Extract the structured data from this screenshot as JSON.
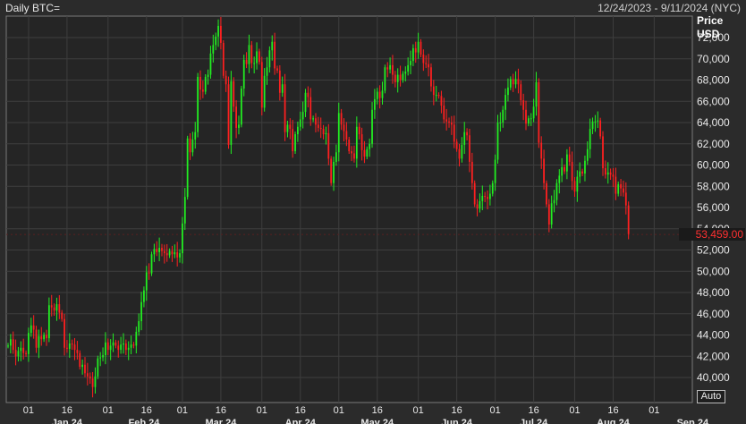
{
  "header": {
    "title": "Daily BTC=",
    "date_range": "12/24/2023 - 9/11/2024 (NYC)"
  },
  "controls": {
    "auto_label": "Auto"
  },
  "chart_data": {
    "type": "candlestick",
    "ylabel": "Price",
    "yunit": "USD",
    "ylim": [
      38400,
      74200
    ],
    "yticks": [
      40000,
      42000,
      44000,
      46000,
      48000,
      50000,
      52000,
      54000,
      56000,
      58000,
      60000,
      62000,
      64000,
      66000,
      68000,
      70000,
      72000
    ],
    "ytick_labels": [
      "40,000",
      "42,000",
      "44,000",
      "46,000",
      "48,000",
      "50,000",
      "52,000",
      "54,000",
      "56,000",
      "58,000",
      "60,000",
      "62,000",
      "64,000",
      "66,000",
      "68,000",
      "70,000",
      "72,000"
    ],
    "x_range": [
      "2023-12-24",
      "2024-09-11"
    ],
    "x_ticks": [
      {
        "date": "2024-01-01",
        "label": "01"
      },
      {
        "date": "2024-01-16",
        "label": "16"
      },
      {
        "date": "2024-02-01",
        "label": "01"
      },
      {
        "date": "2024-02-16",
        "label": "16"
      },
      {
        "date": "2024-03-01",
        "label": "01"
      },
      {
        "date": "2024-03-16",
        "label": "16"
      },
      {
        "date": "2024-04-01",
        "label": "01"
      },
      {
        "date": "2024-04-16",
        "label": "16"
      },
      {
        "date": "2024-05-01",
        "label": "01"
      },
      {
        "date": "2024-05-16",
        "label": "16"
      },
      {
        "date": "2024-06-01",
        "label": "01"
      },
      {
        "date": "2024-06-16",
        "label": "16"
      },
      {
        "date": "2024-07-01",
        "label": "01"
      },
      {
        "date": "2024-07-16",
        "label": "16"
      },
      {
        "date": "2024-08-01",
        "label": "01"
      },
      {
        "date": "2024-08-16",
        "label": "16"
      },
      {
        "date": "2024-09-01",
        "label": "01"
      }
    ],
    "months": [
      {
        "date": "2024-01-16",
        "label": "Jan 24"
      },
      {
        "date": "2024-02-15",
        "label": "Feb 24"
      },
      {
        "date": "2024-03-16",
        "label": "Mar 24"
      },
      {
        "date": "2024-04-16",
        "label": "Apr 24"
      },
      {
        "date": "2024-05-16",
        "label": "May 24"
      },
      {
        "date": "2024-06-16",
        "label": "Jun 24"
      },
      {
        "date": "2024-07-16",
        "label": "Jul 24"
      },
      {
        "date": "2024-08-16",
        "label": "Aug 24"
      },
      {
        "date": "2024-09-16",
        "label": "Sep 24"
      }
    ],
    "last_price": 53459.0,
    "last_price_label": "53,459.00",
    "colors": {
      "up": "#22ee22",
      "down": "#ff2020",
      "grid": "#3e3e3e",
      "last": "#ff3030"
    },
    "grid": true,
    "series": [
      {
        "date": "2023-12-24",
        "values": [
          43000,
          43600,
          42600,
          42000,
          42500,
          42800,
          42300,
          42200,
          44200,
          44900,
          44500,
          42800,
          43900,
          43600,
          44000,
          43700,
          46800,
          46600,
          46300,
          46900,
          46100,
          45500,
          42800,
          42700,
          43200,
          43100,
          42600,
          42300,
          41000,
          41200,
          40400,
          40100,
          39900,
          39100,
          40100,
          41800,
          41900,
          42100,
          43300,
          42600,
          43000,
          43300,
          43000,
          42600,
          43100,
          43200,
          42600,
          42800,
          43100,
          43000,
          44300,
          45300,
          47100,
          48200,
          49900,
          49800,
          51600,
          52100,
          51800,
          52200,
          51900,
          51700,
          51500,
          51900,
          51600,
          51800,
          51300,
          51700,
          54500,
          57000,
          62500,
          61200,
          62400,
          63100,
          68300,
          67100,
          66900,
          68300,
          68500,
          70500,
          71300,
          72100,
          73100,
          71500,
          68400,
          67600,
          61900,
          67900,
          65500,
          63500,
          63800,
          67200,
          69900,
          69500,
          71300,
          69600,
          69600,
          70700,
          69700,
          65400,
          68400,
          69200,
          70800,
          71600,
          69100,
          68900,
          66800,
          67600,
          63100,
          63800,
          63400,
          61300,
          62900,
          63600,
          64300,
          65000,
          66800,
          66400,
          64300,
          64400,
          63800,
          63500,
          63400,
          62900,
          63000,
          60600,
          58300,
          60300,
          61200,
          64900,
          63800,
          63200,
          62400,
          61300,
          61100,
          60600,
          63600,
          62900,
          61400,
          60800,
          61500,
          62000,
          65200,
          66200,
          66900,
          66300,
          67000,
          69200,
          69000,
          69400,
          68500,
          67800,
          68500,
          68000,
          68600,
          68800,
          69400,
          69800,
          71000,
          70600,
          71600,
          70400,
          69600,
          69500,
          69200,
          67400,
          66600,
          66600,
          66500,
          65600,
          64300,
          64100,
          64000,
          63800,
          62200,
          61500,
          60600,
          61900,
          63100,
          62800,
          60300,
          58300,
          56300,
          55900,
          56600,
          57100,
          57000,
          56800,
          57300,
          58300,
          60500,
          64000,
          64000,
          65200,
          66600,
          67300,
          68100,
          67600,
          68100,
          67600,
          66100,
          65200,
          63900,
          64400,
          64400,
          65500,
          67800,
          62100,
          60600,
          58300,
          56300,
          54400,
          56400,
          56700,
          58300,
          59000,
          59800,
          59400,
          61000,
          60300,
          58500,
          57500,
          58900,
          59400,
          59200,
          60400,
          61500,
          63400,
          64100,
          64100,
          64200,
          62700,
          59700,
          59100,
          59300,
          59100,
          58900,
          57300,
          58200,
          57800,
          57400,
          56200,
          53500
        ]
      }
    ]
  }
}
